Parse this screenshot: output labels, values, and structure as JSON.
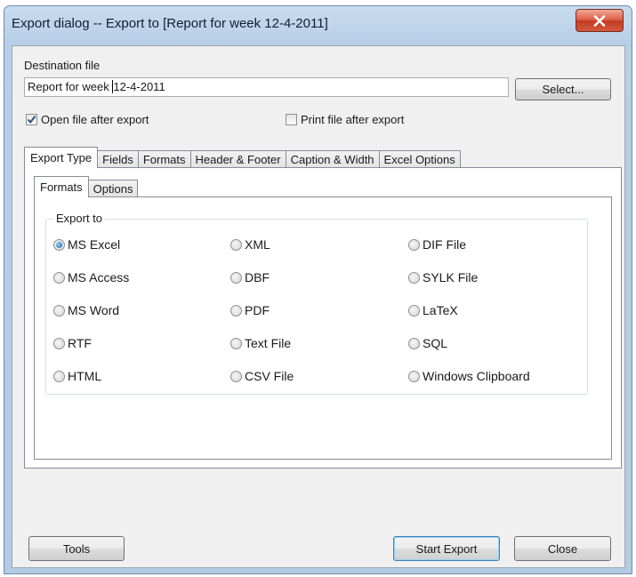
{
  "window": {
    "title": "Export dialog -- Export to [Report for week 12-4-2011]",
    "close_glyph": "X"
  },
  "destination": {
    "label": "Destination file",
    "value_before_caret": "Report for week ",
    "value_after_caret": "12-4-2011",
    "select_label": "Select..."
  },
  "options": {
    "open_after_label": "Open file after export",
    "open_after_checked": true,
    "print_after_label": "Print file after export",
    "print_after_checked": false
  },
  "tabs": [
    {
      "label": "Export Type",
      "active": true
    },
    {
      "label": "Fields",
      "active": false
    },
    {
      "label": "Formats",
      "active": false
    },
    {
      "label": "Header & Footer",
      "active": false
    },
    {
      "label": "Caption & Width",
      "active": false
    },
    {
      "label": "Excel Options",
      "active": false
    }
  ],
  "subtabs": [
    {
      "label": "Formats",
      "active": true
    },
    {
      "label": "Options",
      "active": false
    }
  ],
  "export_to": {
    "legend": "Export to",
    "selected": "MS Excel",
    "columns": [
      [
        "MS Excel",
        "MS Access",
        "MS Word",
        "RTF",
        "HTML"
      ],
      [
        "XML",
        "DBF",
        "PDF",
        "Text File",
        "CSV File"
      ],
      [
        "DIF File",
        "SYLK File",
        "LaTeX",
        "SQL",
        "Windows Clipboard"
      ]
    ]
  },
  "footer": {
    "tools_label": "Tools",
    "start_label": "Start Export",
    "close_label": "Close"
  },
  "colors": {
    "accent": "#3c7fb1",
    "window_frame": "#b7cfe7",
    "close_button": "#c23b22"
  }
}
